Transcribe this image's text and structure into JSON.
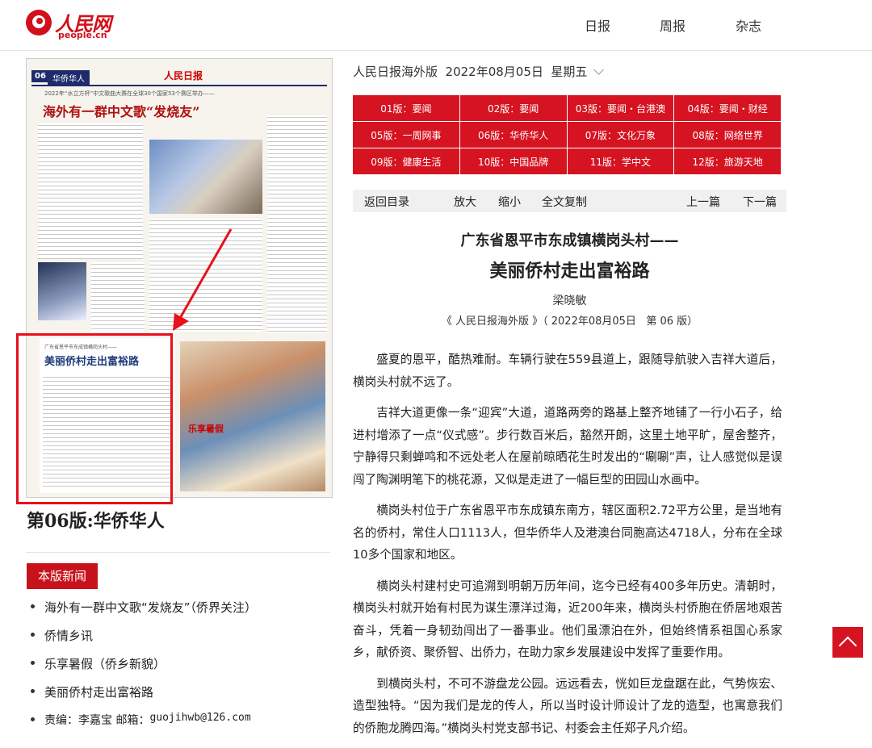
{
  "header": {
    "logo_cn": "人民网",
    "logo_en": "people.cn",
    "nav": [
      "日报",
      "周报",
      "杂志"
    ]
  },
  "thumbnail": {
    "page_badge": "06",
    "section": "华侨华人",
    "masthead": "人民日报",
    "headline_top": "海外有一群中文歌“发烧友”",
    "subhead_top": "2022年“水立方杯”中文歌曲大赛在全球30个国家53个赛区举办——",
    "headline_bottom": "美丽侨村走出富裕路",
    "subhead_bottom": "广东省恩平市东成镇横岗头村——",
    "photo_caption": "乐享暑假"
  },
  "edition_title": "第06版:华侨华人",
  "news_section": {
    "tag": "本版新闻",
    "items": [
      "海外有一群中文歌“发烧友”（侨界关注）",
      "侨情乡讯",
      "乐享暑假（侨乡新貌）",
      "美丽侨村走出富裕路"
    ],
    "editor_label": "责编：李嘉宝 邮箱：",
    "editor_email": "guojihwb@126.com"
  },
  "date_line": "人民日报海外版  2022年08月05日  星期五",
  "editions": [
    "01版：要闻",
    "02版：要闻",
    "03版：要闻・台港澳",
    "04版：要闻・财经",
    "05版：一周网事",
    "06版：华侨华人",
    "07版：文化万象",
    "08版：网络世界",
    "09版：健康生活",
    "10版：中国品牌",
    "11版：学中文",
    "12版：旅游天地"
  ],
  "toolbar": {
    "back": "返回目录",
    "zoom_in": "放大",
    "zoom_out": "缩小",
    "copy_all": "全文复制",
    "prev": "上一篇",
    "next": "下一篇"
  },
  "article": {
    "title_line1": "广东省恩平市东成镇横岗头村——",
    "title_line2": "美丽侨村走出富裕路",
    "author": "梁晓敏",
    "source": "《 人民日报海外版 》（ 2022年08月05日   第 06 版）",
    "paragraphs": [
      "盛夏的恩平，酷热难耐。车辆行驶在559县道上，跟随导航驶入吉祥大道后，横岗头村就不远了。",
      "吉祥大道更像一条“迎宾”大道，道路两旁的路基上整齐地铺了一行小石子，给进村增添了一点“仪式感”。步行数百米后，豁然开朗，这里土地平旷，屋舍整齐，宁静得只剩蝉鸣和不远处老人在屋前晾晒花生时发出的“唰唰”声，让人感觉似是误闯了陶渊明笔下的桃花源，又似是走进了一幅巨型的田园山水画中。",
      "横岗头村位于广东省恩平市东成镇东南方，辖区面积2.72平方公里，是当地有名的侨村，常住人口1113人，但华侨华人及港澳台同胞高达4718人，分布在全球10多个国家和地区。",
      "横岗头村建村史可追溯到明朝万历年间，迄今已经有400多年历史。清朝时，横岗头村就开始有村民为谋生漂洋过海，近200年来，横岗头村侨胞在侨居地艰苦奋斗，凭着一身韧劲闯出了一番事业。他们虽漂泊在外，但始终情系祖国心系家乡，献侨资、聚侨智、出侨力，在助力家乡发展建设中发挥了重要作用。",
      "到横岗头村，不可不游盘龙公园。远远看去，恍如巨龙盘踞在此，气势恢宏、造型独特。“因为我们是龙的传人，所以当时设计师设计了龙的造型，也寓意我们的侨胞龙腾四海。”横岗头村党支部书记、村委会主任郑子凡介绍。"
    ]
  },
  "colors": {
    "brand_red": "#d51321",
    "highlight_red": "#e8101a"
  }
}
